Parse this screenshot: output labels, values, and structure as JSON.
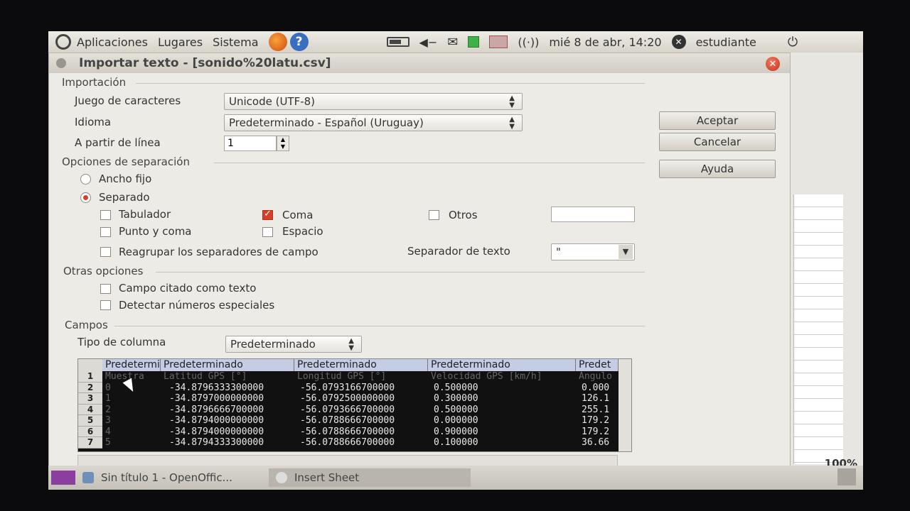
{
  "top_panel": {
    "menu": [
      "Aplicaciones",
      "Lugares",
      "Sistema"
    ],
    "clock": "mié  8 de abr, 14:20",
    "user": "estudiante"
  },
  "dialog": {
    "title": "Importar texto - [sonido%20latu.csv]",
    "importacion": {
      "section": "Importación",
      "charset_label": "Juego de caracteres",
      "charset_value": "Unicode (UTF-8)",
      "language_label": "Idioma",
      "language_value": "Predeterminado - Español (Uruguay)",
      "from_line_label": "A partir de línea",
      "from_line_value": "1"
    },
    "separacion": {
      "section": "Opciones de separación",
      "fixed_width": "Ancho fijo",
      "separated": "Separado",
      "tab": "Tabulador",
      "semicolon": "Punto y coma",
      "comma": "Coma",
      "space": "Espacio",
      "other": "Otros",
      "merge": "Reagrupar los separadores de campo",
      "text_delim_label": "Separador de texto",
      "text_delim_value": "\""
    },
    "otras": {
      "section": "Otras opciones",
      "quoted_as_text": "Campo citado como texto",
      "detect_special": "Detectar números especiales"
    },
    "campos": {
      "section": "Campos",
      "col_type_label": "Tipo de columna",
      "col_type_value": "Predeterminado"
    },
    "buttons": {
      "ok": "Aceptar",
      "cancel": "Cancelar",
      "help": "Ayuda"
    },
    "preview": {
      "headers": [
        "Predeterminado",
        "Predeterminado",
        "Predeterminado",
        "Predeterminado",
        "Predet"
      ],
      "rows": [
        [
          "1",
          "Muestra",
          "Latitud GPS [°]",
          "Longitud GPS [°]",
          "Velocidad GPS [km/h]",
          "Ángulo"
        ],
        [
          "2",
          "0",
          "-34.8796333300000",
          "-56.0793166700000",
          "0.500000",
          "0.000"
        ],
        [
          "3",
          "1",
          "-34.8797000000000",
          "-56.0792500000000",
          "0.300000",
          "126.1"
        ],
        [
          "4",
          "2",
          "-34.8796666700000",
          "-56.0793666700000",
          "0.500000",
          "255.1"
        ],
        [
          "5",
          "3",
          "-34.8794000000000",
          "-56.0788666700000",
          "0.000000",
          "179.2"
        ],
        [
          "6",
          "4",
          "-34.8794000000000",
          "-56.0788666700000",
          "0.900000",
          "179.2"
        ],
        [
          "7",
          "5",
          "-34.8794333300000",
          "-56.0788666700000",
          "0.100000",
          "36.66"
        ]
      ]
    }
  },
  "taskbar": {
    "items": [
      "Sin título 1 - OpenOffic...",
      "Insert Sheet"
    ],
    "zoom": "100%"
  }
}
